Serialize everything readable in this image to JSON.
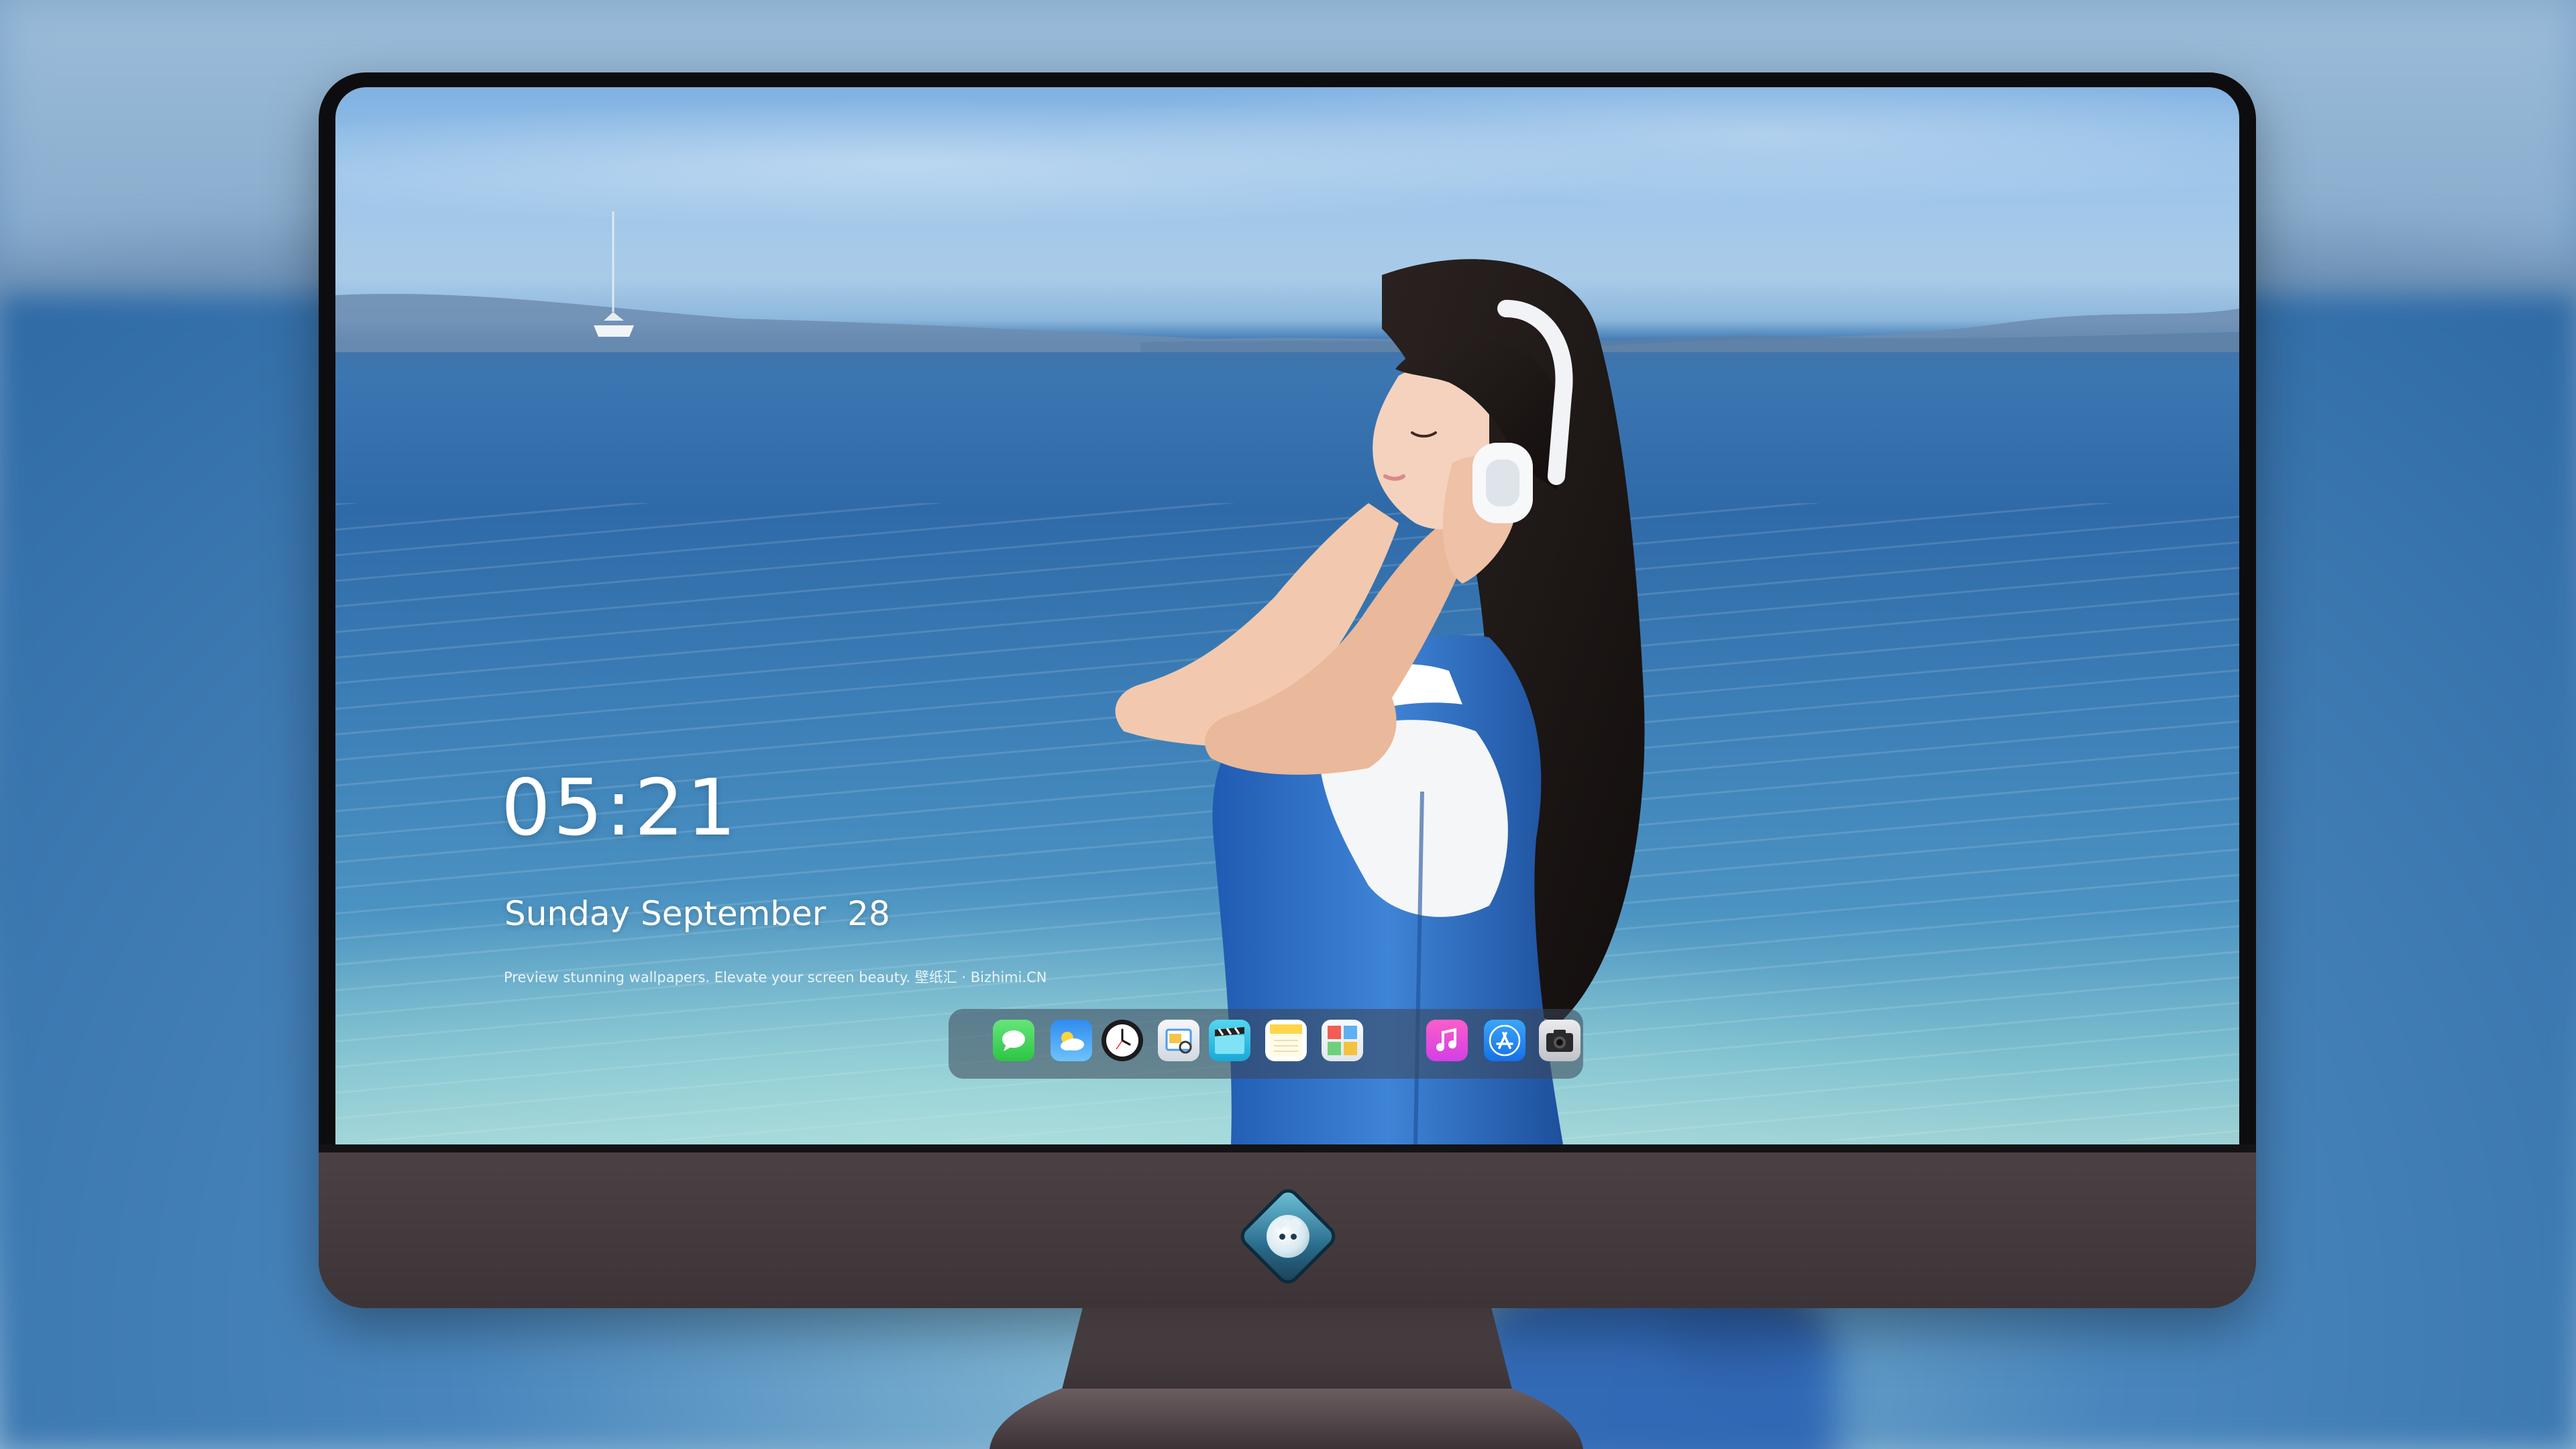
{
  "lock_screen": {
    "time": "05:21",
    "date": "Sunday September  28",
    "tagline": "Preview stunning wallpapers. Elevate your screen beauty. 壁纸汇 · Bizhimi.CN"
  },
  "dock": {
    "apps": [
      {
        "name": "Messages",
        "icon": "messages-icon"
      },
      {
        "name": "Weather",
        "icon": "weather-icon"
      },
      {
        "name": "Clock",
        "icon": "clock-icon"
      },
      {
        "name": "Preview",
        "icon": "preview-icon"
      },
      {
        "name": "Clips",
        "icon": "clips-icon"
      },
      {
        "name": "Notes",
        "icon": "notes-icon"
      },
      {
        "name": "Calendar",
        "icon": "calendar-icon"
      },
      {
        "name": "Music",
        "icon": "music-icon"
      },
      {
        "name": "App Store",
        "icon": "app-store-icon"
      },
      {
        "name": "Camera",
        "icon": "camera-icon"
      }
    ]
  },
  "colors": {
    "bezel": "#0d0d0f",
    "chin": "#443a3d",
    "dock_bg": "rgba(60,70,85,.55)",
    "dress": "#2f6cc4",
    "sea": "#2f6aa8"
  }
}
